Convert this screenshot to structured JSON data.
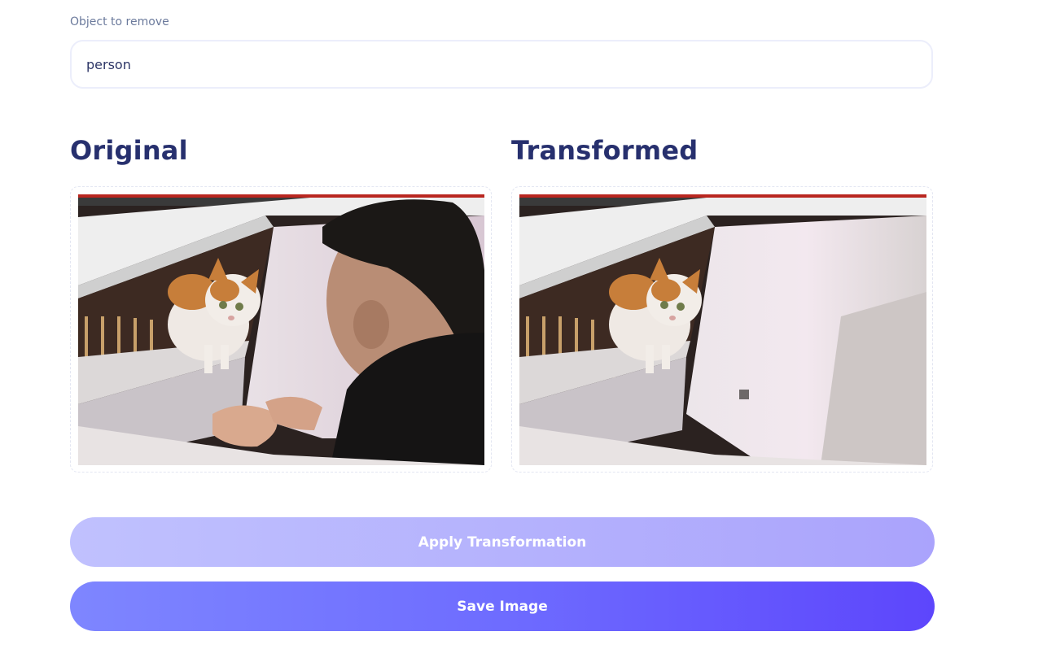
{
  "form": {
    "object_label": "Object to remove",
    "object_value": "person"
  },
  "panels": {
    "original_title": "Original",
    "transformed_title": "Transformed"
  },
  "buttons": {
    "apply_label": "Apply Transformation",
    "save_label": "Save Image"
  },
  "colors": {
    "heading": "#27306e",
    "label": "#6b7a9c",
    "apply_button_start": "#c0c1fe",
    "apply_button_end": "#aaa3fc",
    "save_button_start": "#7e86ff",
    "save_button_end": "#5d46fc"
  }
}
